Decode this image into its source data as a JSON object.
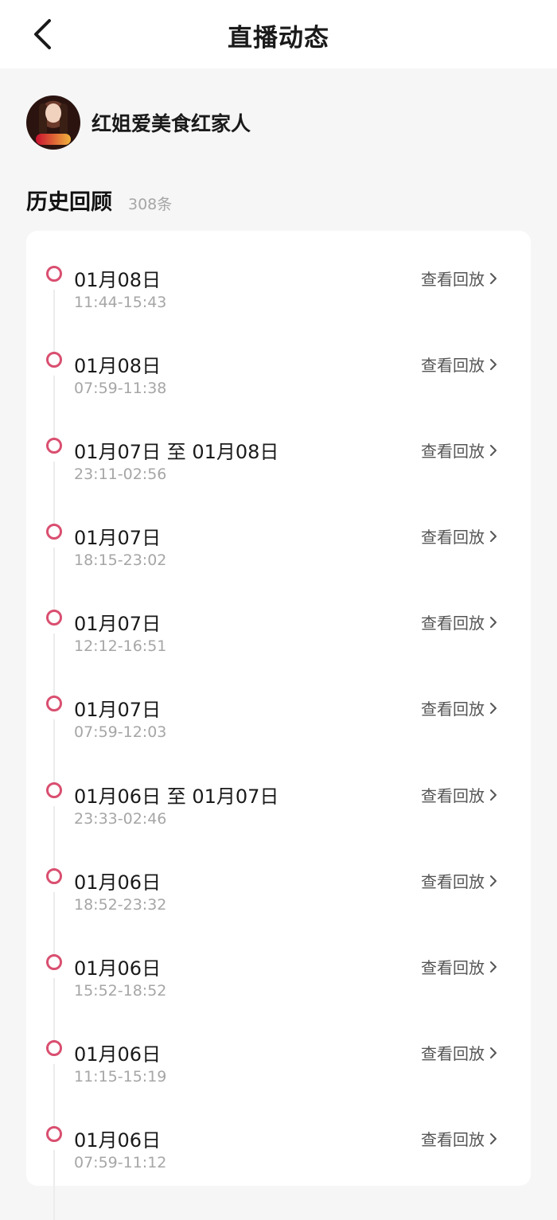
{
  "header": {
    "title": "直播动态"
  },
  "profile": {
    "name": "红姐爱美食红家人"
  },
  "history": {
    "title": "历史回顾",
    "count": "308条"
  },
  "colors": {
    "accent": "#d94f70",
    "background": "#f6f6f6",
    "secondary_text": "#a6a6a6"
  },
  "sessions": [
    {
      "date": "01月08日",
      "time": "11:44-15:43",
      "action": "查看回放"
    },
    {
      "date": "01月08日",
      "time": "07:59-11:38",
      "action": "查看回放"
    },
    {
      "date": "01月07日 至 01月08日",
      "time": "23:11-02:56",
      "action": "查看回放"
    },
    {
      "date": "01月07日",
      "time": "18:15-23:02",
      "action": "查看回放"
    },
    {
      "date": "01月07日",
      "time": "12:12-16:51",
      "action": "查看回放"
    },
    {
      "date": "01月07日",
      "time": "07:59-12:03",
      "action": "查看回放"
    },
    {
      "date": "01月06日 至 01月07日",
      "time": "23:33-02:46",
      "action": "查看回放"
    },
    {
      "date": "01月06日",
      "time": "18:52-23:32",
      "action": "查看回放"
    },
    {
      "date": "01月06日",
      "time": "15:52-18:52",
      "action": "查看回放"
    },
    {
      "date": "01月06日",
      "time": "11:15-15:19",
      "action": "查看回放"
    },
    {
      "date": "01月06日",
      "time": "07:59-11:12",
      "action": "查看回放"
    }
  ]
}
